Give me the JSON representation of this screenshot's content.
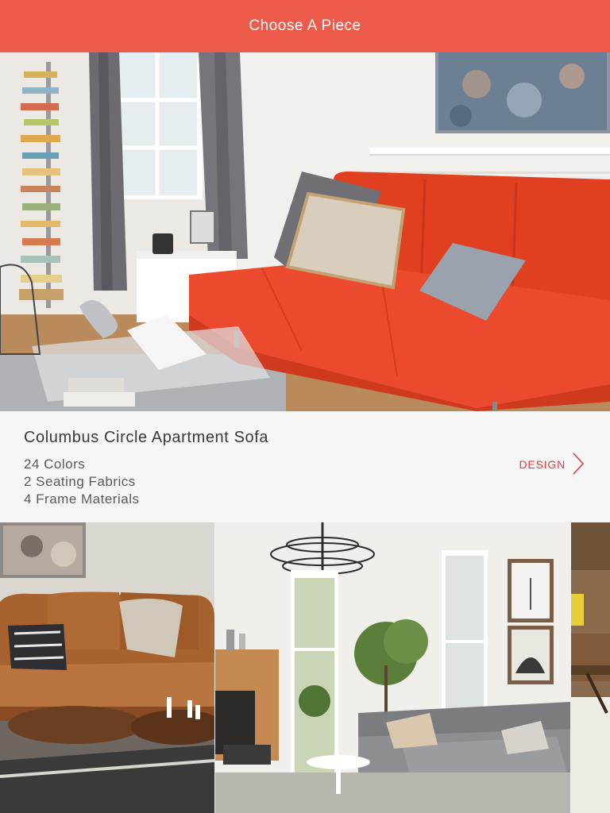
{
  "header": {
    "title": "Choose A Piece"
  },
  "featured": {
    "name": "Columbus Circle Apartment Sofa",
    "features": [
      "24 Colors",
      "2 Seating Fabrics",
      "4 Frame Materials"
    ],
    "design_label": "DESIGN"
  },
  "colors": {
    "brand": "#ef5b4a",
    "accent_link": "#e63b3f",
    "sofa": "#ec4a2c"
  },
  "icons": {
    "design_arrow": "chevron-right-icon"
  },
  "carousel": {
    "items": [
      "leather-sofa-photo",
      "gray-sectional-photo",
      "wood-table-photo"
    ]
  }
}
